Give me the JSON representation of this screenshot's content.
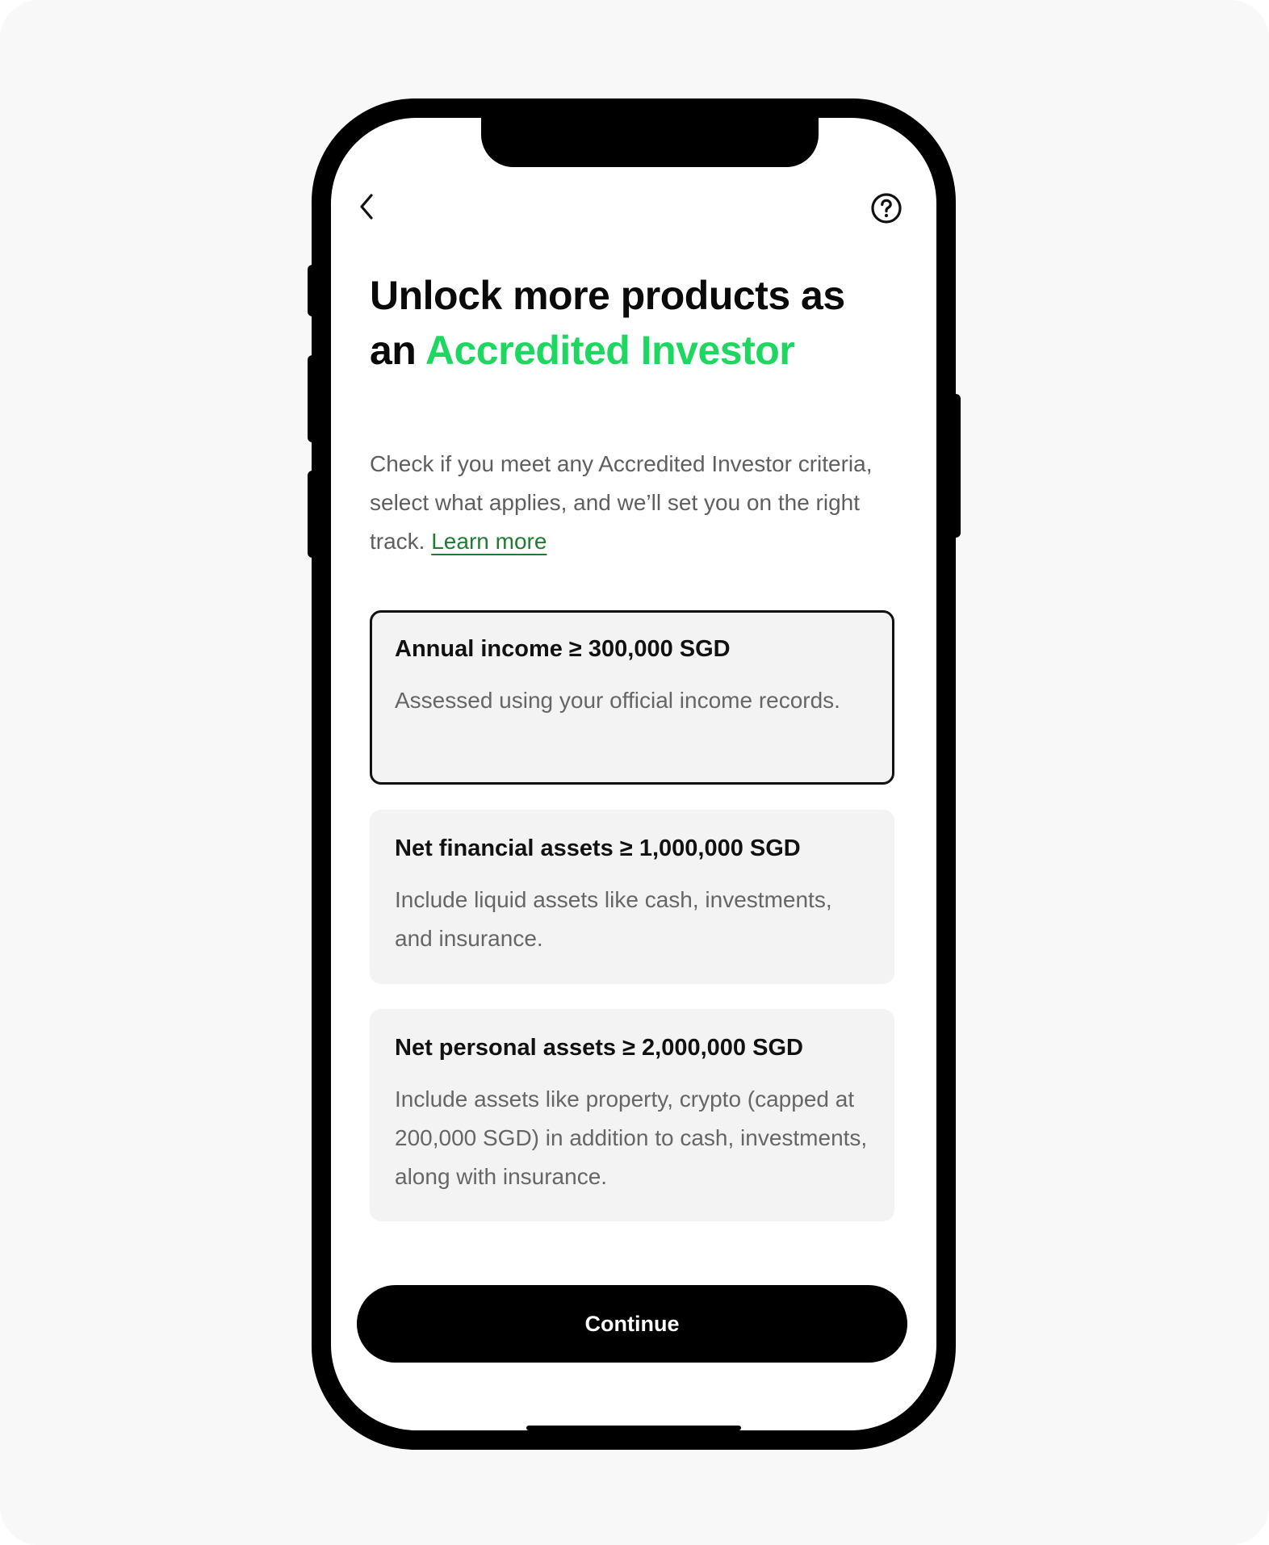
{
  "header": {
    "back_icon": "chevron-left-icon",
    "help_icon": "question-circle-icon"
  },
  "title": {
    "part1": "Unlock more products as an ",
    "accent": "Accredited Investor",
    "accent_color": "#1ed760"
  },
  "subtitle": {
    "text": "Check if you meet any Accredited Investor criteria, select what applies, and we’ll set you on the right track. ",
    "link": "Learn more",
    "link_color": "#1e7d32"
  },
  "options": [
    {
      "title": "Annual income ≥ 300,000 SGD",
      "description": "Assessed using your official income records.",
      "selected": true
    },
    {
      "title": "Net financial assets ≥ 1,000,000 SGD",
      "description": "Include liquid assets like cash, investments, and insurance.",
      "selected": false
    },
    {
      "title": "Net personal assets ≥ 2,000,000 SGD",
      "description": "Include assets like property, crypto (capped at 200,000 SGD) in addition to cash, investments, along with insurance.",
      "selected": false
    }
  ],
  "footer": {
    "continue_label": "Continue"
  },
  "colors": {
    "card_background": "#f3f3f3",
    "button_background": "#000000",
    "page_background": "#f8f8f8"
  }
}
